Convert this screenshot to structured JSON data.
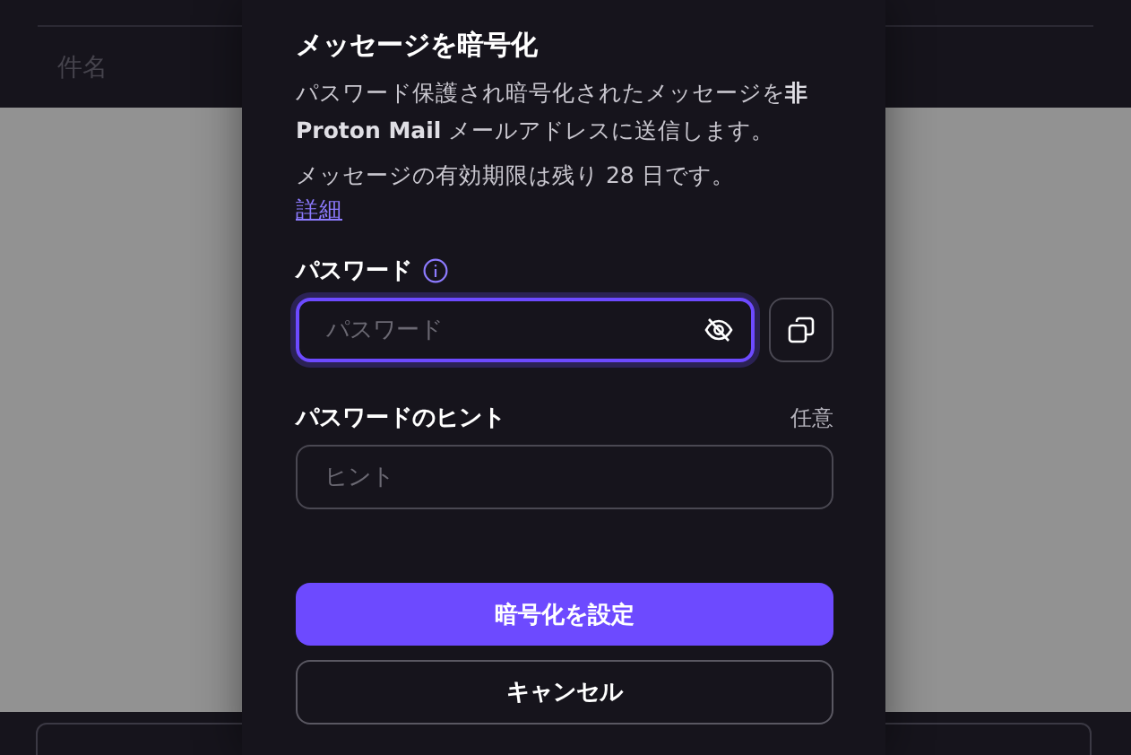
{
  "composer": {
    "subject_placeholder": "件名"
  },
  "modal": {
    "title": "メッセージを暗号化",
    "description": "パスワード保護され暗号化されたメッセージを**非 Proton Mail** メールアドレスに送信します。",
    "expiry": "メッセージの有効期限は残り 28 日です。",
    "link": "詳細",
    "fields": [
      {
        "label": "パスワード",
        "placeholder": "パスワード",
        "focused": true,
        "kind": "password"
      },
      {
        "label": "パスワードのヒント",
        "hint_label": "任意",
        "placeholder": "ヒント",
        "focused": false,
        "kind": "text"
      }
    ],
    "buttons": [
      {
        "label": "暗号化を設定",
        "kind": "primary"
      },
      {
        "label": "キャンセル",
        "kind": "secondary"
      }
    ]
  }
}
